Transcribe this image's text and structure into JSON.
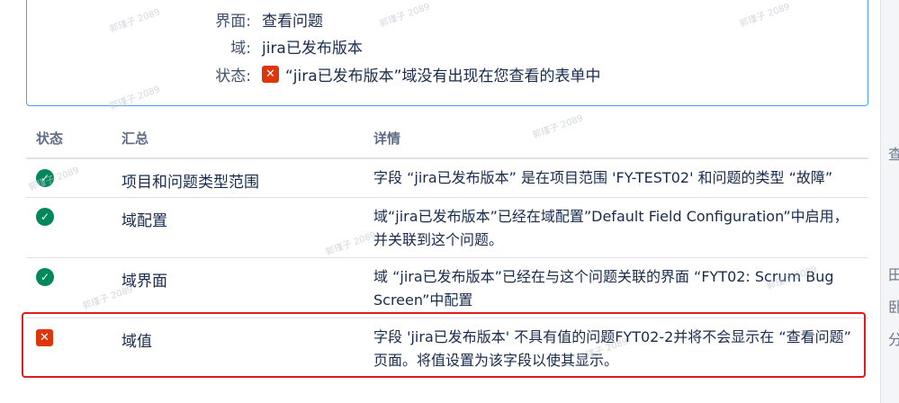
{
  "summary": {
    "screen_label": "界面:",
    "screen_value": "查看问题",
    "field_label": "域:",
    "field_value": "jira已发布版本",
    "status_label": "状态:",
    "status_value": "“jira已发布版本”域没有出现在您查看的表单中"
  },
  "table": {
    "headers": {
      "status": "状态",
      "summary": "汇总",
      "details": "详情"
    },
    "rows": [
      {
        "status": "ok",
        "summary": "项目和问题类型范围",
        "details": "字段 “jira已发布版本” 是在项目范围 'FY-TEST02' 和问题的类型 “故障”"
      },
      {
        "status": "ok",
        "summary": "域配置",
        "details": "域“jira已发布版本”已经在域配置”Default Field Configuration”中启用，并关联到这个问题。"
      },
      {
        "status": "ok",
        "summary": "域界面",
        "details": "域 “jira已发布版本”已经在与这个问题关联的界面 “FYT02: Scrum Bug Screen”中配置"
      },
      {
        "status": "error",
        "summary": "域值",
        "details": "字段 'jira已发布版本' 不具有值的问题FYT02-2并将不会显示在 “查看问题” 页面。将值设置为该字段以使其显示。"
      }
    ]
  },
  "icons": {
    "ok": "check-circle-icon",
    "error": "error-x-icon"
  },
  "colors": {
    "ok": "#00875a",
    "error": "#de350b",
    "highlight": "#e01b1b",
    "box_border": "#4c9aff"
  },
  "watermark": "郭瑾子 2089",
  "background_strip": [
    "查",
    "田",
    "卧",
    "分"
  ]
}
